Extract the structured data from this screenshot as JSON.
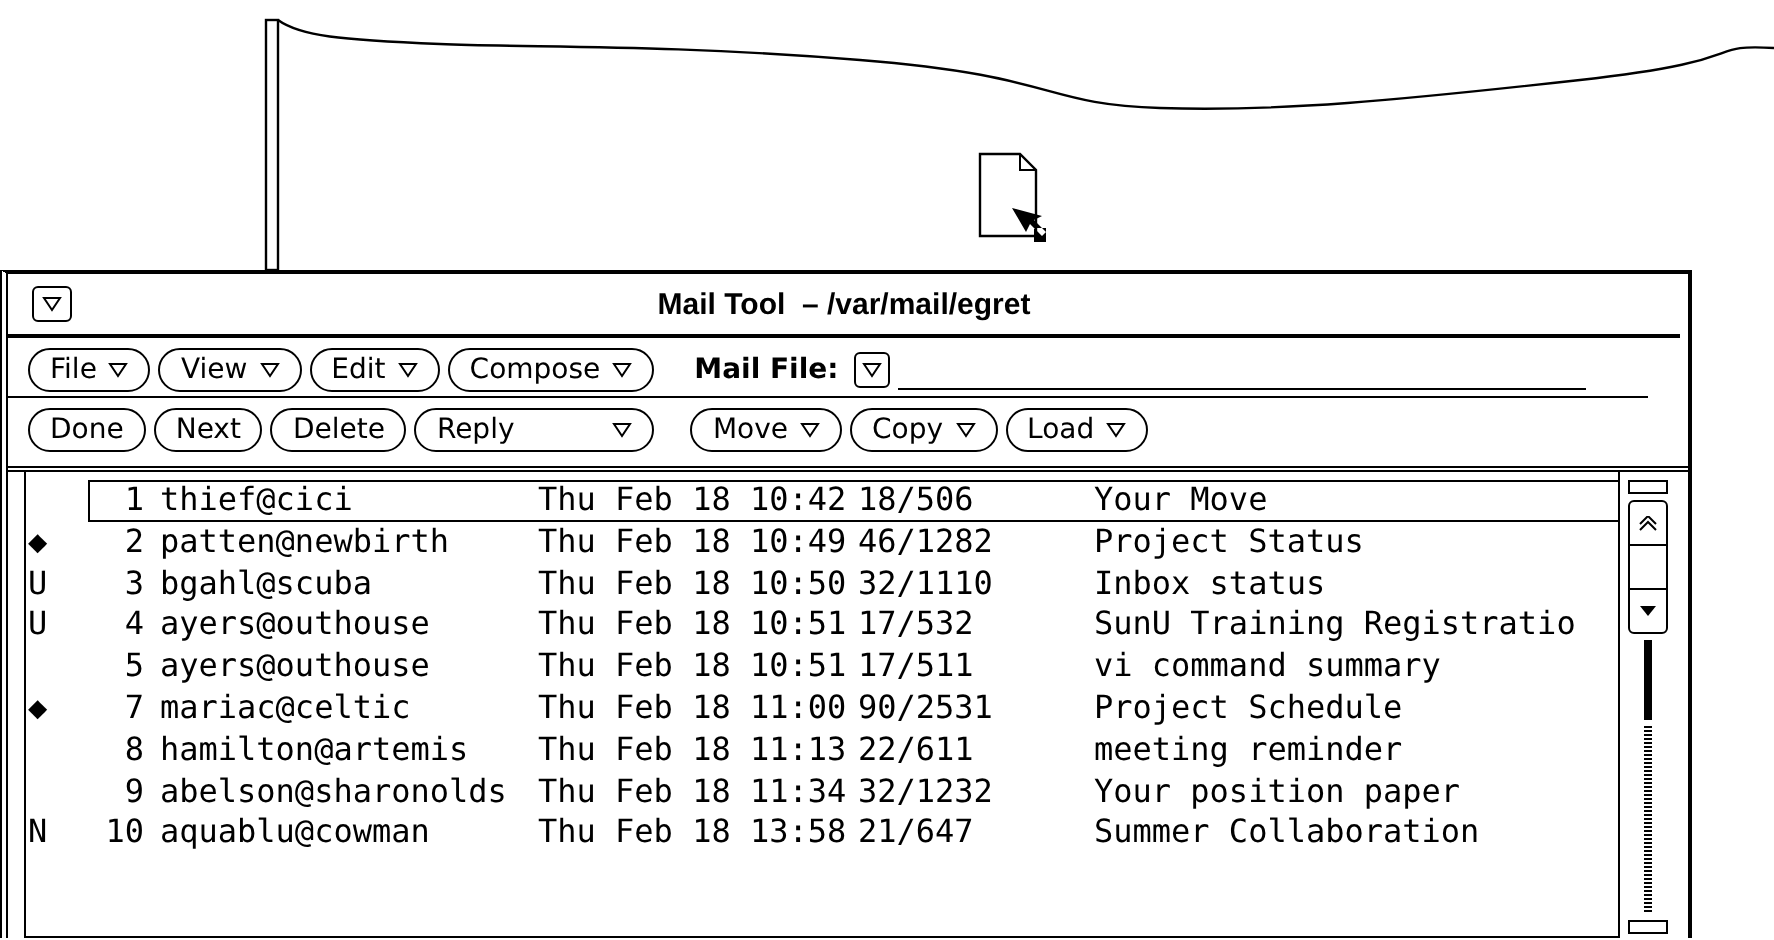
{
  "window": {
    "title": "Mail Tool  – /var/mail/egret"
  },
  "menu_buttons": [
    {
      "label": "File",
      "has_menu": true
    },
    {
      "label": "View",
      "has_menu": true
    },
    {
      "label": "Edit",
      "has_menu": true
    },
    {
      "label": "Compose",
      "has_menu": true
    }
  ],
  "mail_file": {
    "label": "Mail File:"
  },
  "action_buttons": [
    {
      "label": "Done",
      "has_menu": false
    },
    {
      "label": "Next",
      "has_menu": false
    },
    {
      "label": "Delete",
      "has_menu": false
    },
    {
      "label": "Reply",
      "has_menu": true
    }
  ],
  "file_buttons": [
    {
      "label": "Move",
      "has_menu": true
    },
    {
      "label": "Copy",
      "has_menu": true
    },
    {
      "label": "Load",
      "has_menu": true
    }
  ],
  "messages": [
    {
      "number": "1",
      "sender": "thief@cici",
      "date": "Thu Feb 18 10:42",
      "size": "18/506",
      "subject": "Your Move",
      "selected": true
    },
    {
      "status": "◆",
      "number": "2",
      "sender": "patten@newbirth",
      "date": "Thu Feb 18 10:49",
      "size": "46/1282",
      "subject": "Project Status",
      "selected": false
    },
    {
      "status": "U",
      "number": "3",
      "sender": "bgahl@scuba",
      "date": "Thu Feb 18 10:50",
      "size": "32/1110",
      "subject": "Inbox status",
      "selected": false
    },
    {
      "status": "U",
      "number": "4",
      "sender": "ayers@outhouse",
      "date": "Thu Feb 18 10:51",
      "size": "17/532",
      "subject": "SunU Training Registratio",
      "selected": false
    },
    {
      "number": "5",
      "sender": "ayers@outhouse",
      "date": "Thu Feb 18 10:51",
      "size": "17/511",
      "subject": "vi command summary",
      "selected": false
    },
    {
      "status": "◆",
      "number": "7",
      "sender": "mariac@celtic",
      "date": "Thu Feb 18 11:00",
      "size": "90/2531",
      "subject": "Project Schedule",
      "selected": false
    },
    {
      "number": "8",
      "sender": "hamilton@artemis",
      "date": "Thu Feb 18 11:13",
      "size": "22/611",
      "subject": "meeting reminder",
      "selected": false
    },
    {
      "number": "9",
      "sender": "abelson@sharonolds",
      "date": "Thu Feb 18 11:34",
      "size": "32/1232",
      "subject": "Your position paper",
      "selected": false
    },
    {
      "status": "N",
      "number": "10",
      "sender": "aquablu@cowman",
      "date": "Thu Feb 18 13:58",
      "size": "21/647",
      "subject": "Summer Collaboration",
      "selected": false
    }
  ]
}
